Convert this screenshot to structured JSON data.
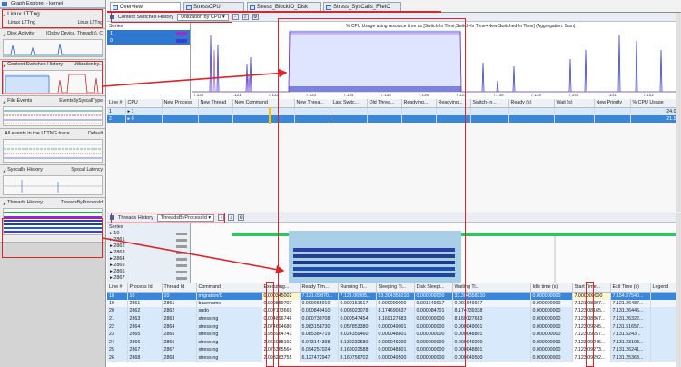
{
  "explorer": {
    "window_title": "Graph Explorer - kernel",
    "root": {
      "title": "Linux LTTng",
      "sub_left": "Linux LTTng",
      "sub_right": "Linux LTTng"
    },
    "sections": [
      {
        "name": "Disk Activity",
        "sub": "IOs by Device, Thread(s), C"
      },
      {
        "name": "Context Switches History",
        "sub": "Utilization by..."
      },
      {
        "name": "File Events",
        "sub": "EventsBySyscallType"
      },
      {
        "name": "All events in the LTTNG trace",
        "sub": "Default"
      },
      {
        "name": "Syscalls History",
        "sub": "Syscall Latency"
      },
      {
        "name": "Threads History",
        "sub": "ThreadsByProcessId"
      }
    ]
  },
  "tabs": [
    "Overview",
    "StressCPU",
    "Stress_BlockIO_Disk",
    "Stress_SysCalls_FileIO"
  ],
  "context_panel": {
    "title": "Context Switches History",
    "view": "Utilization by CPU",
    "series_label": "Series",
    "series": [
      {
        "name": "1",
        "color": "#9b30c8"
      },
      {
        "name": "0",
        "color": "#3a3fd0"
      }
    ],
    "chart_title": "% CPU Usage using resource time as [Switch-In Time,Switch-In Time+New Switched-In Time] (Aggregation: Sum)",
    "ticks": [
      "7.130",
      "7.131",
      "7.132",
      "7.133",
      "7.134",
      "7.135",
      "7.136",
      "7.137",
      "7.138",
      "7.139",
      "7.140",
      "7.141",
      "7.142"
    ],
    "columns": [
      "Line #",
      "CPU",
      "New Process",
      "New Thread",
      "New Command",
      "New Threa...",
      "Last Switc...",
      "Old Threa...",
      "Readying...",
      "Readying...",
      "Switch-In...",
      "Ready (s)",
      "Wait (s)",
      "New Priority",
      "% CPU Usage"
    ],
    "rows": [
      {
        "line": "1",
        "cpu": "1",
        "expand": "▸",
        "usage": "24.08"
      },
      {
        "line": "2",
        "cpu": "0",
        "expand": "▸",
        "usage": "21.54"
      }
    ]
  },
  "threads_panel": {
    "title": "Threads History",
    "view": "ThreadsByProcessId",
    "series_label": "Series",
    "series": [
      "10",
      "2861",
      "2862",
      "2863",
      "2864",
      "2865",
      "2866",
      "2867"
    ],
    "columns": [
      "Line #",
      "Process Id",
      "Thread Id",
      "Command",
      "Executing...",
      "Ready Tim...",
      "Running Ti...",
      "Sleeping Ti...",
      "Disk Sleepi...",
      "Waiting Ti...",
      "Idle time (s)",
      "Start Time...",
      "Exit Time (s)",
      "Legend"
    ],
    "rows": [
      [
        "18",
        "10",
        "10",
        "migration/0",
        "0.000345002",
        "7.121.09870...",
        "7.121.06905...",
        "53.304358210",
        "0.000000000",
        "33.304358210",
        "0.000000000",
        "7.000000000",
        "7.154.57540..."
      ],
      [
        "19",
        "2861",
        "2861",
        "basename",
        "0.000859707",
        "0.000955910",
        "0.000151617",
        "0.000000000",
        "0.001649917",
        "0.001649917",
        "0.000000000",
        "7.121.08307...",
        "7.121.26487..."
      ],
      [
        "20",
        "2862",
        "2862",
        "sudo",
        "0.007173669",
        "0.000849410",
        "0.008023078",
        "8.174690637",
        "0.000084701",
        "8.174739338",
        "0.000000000",
        "7.123.08165...",
        "7.131.26445..."
      ],
      [
        "21",
        "2863",
        "2863",
        "stress-ng",
        "0.004896746",
        "0.000730708",
        "0.000547454",
        "8.169127683",
        "0.000000000",
        "8.169127683",
        "0.000000000",
        "7.123.08867...",
        "7.131.26322..."
      ],
      [
        "22",
        "2864",
        "2864",
        "stress-ng",
        "2.074694680",
        "5.983158730",
        "0.057853380",
        "0.000049001",
        "0.000000000",
        "0.000049001",
        "0.000000000",
        "7.123.09245...",
        "7.131.51657..."
      ],
      [
        "23",
        "2865",
        "2865",
        "stress-ng",
        "1.938964741",
        "6.085384719",
        "8.024359460",
        "0.000048801",
        "0.000000000",
        "0.000048801",
        "0.000000000",
        "7.123.09257...",
        "7.131.5243..."
      ],
      [
        "24",
        "2866",
        "2866",
        "stress-ng",
        "2.066088192",
        "6.073144398",
        "8.139232580",
        "0.000049200",
        "0.000000000",
        "0.000049200",
        "0.000000000",
        "7.123.09245...",
        "7.131.23193..."
      ],
      [
        "25",
        "2867",
        "2867",
        "stress-ng",
        "2.075365564",
        "6.094257024",
        "8.169022588",
        "0.000048801",
        "0.000000000",
        "0.000048801",
        "0.000000000",
        "7.123.09273...",
        "7.131.26241..."
      ],
      [
        "26",
        "2868",
        "2868",
        "stress-ng",
        "2.093283755",
        "6.127472947",
        "8.160756702",
        "0.000049500",
        "0.000000000",
        "0.000049500",
        "0.000000000",
        "7.123.09292...",
        "7.131.25363..."
      ]
    ]
  }
}
